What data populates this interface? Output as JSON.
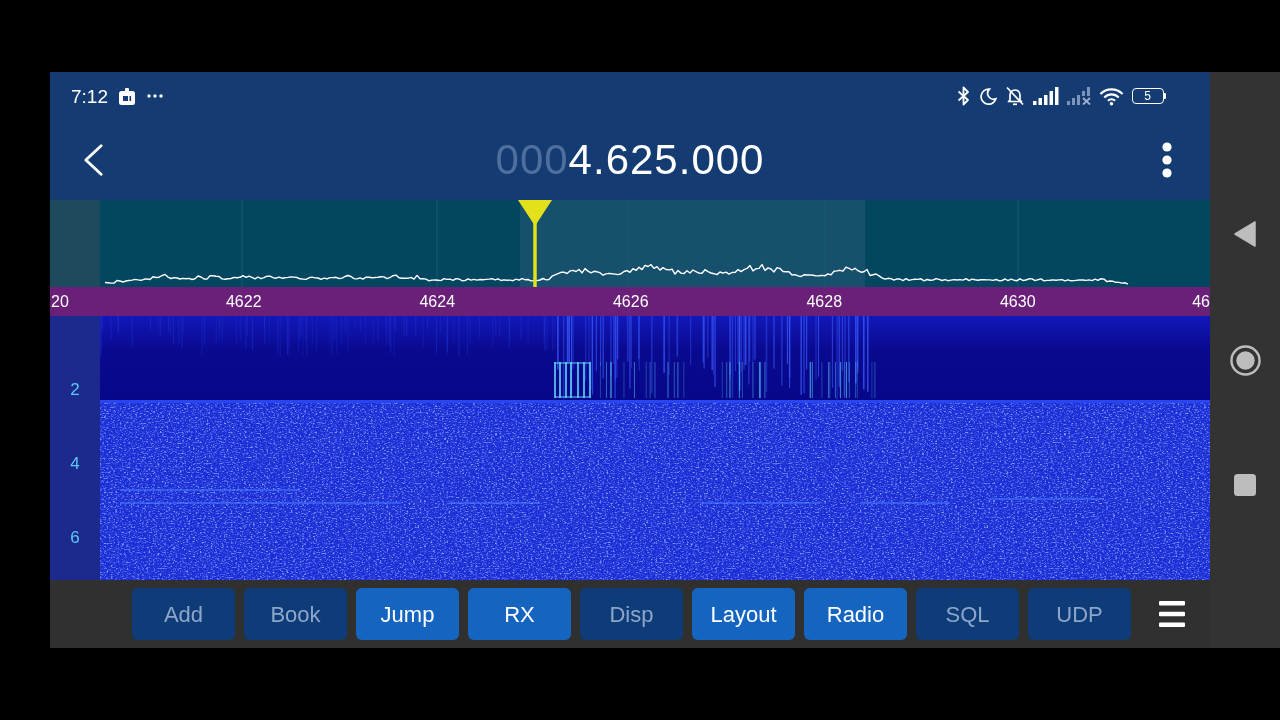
{
  "status_bar": {
    "time": "7:12",
    "battery": "5"
  },
  "header": {
    "frequency": {
      "leading_zeros": "000",
      "digits": "4.625.000"
    }
  },
  "spectrum": {
    "scale_labels": [
      "20",
      "4622",
      "4624",
      "4626",
      "4628",
      "4630",
      "46"
    ]
  },
  "waterfall": {
    "time_labels": [
      "2",
      "4",
      "6"
    ]
  },
  "toolbar": [
    {
      "label": "Add",
      "on": false
    },
    {
      "label": "Book",
      "on": false
    },
    {
      "label": "Jump",
      "on": true
    },
    {
      "label": "RX",
      "on": true
    },
    {
      "label": "Disp",
      "on": false
    },
    {
      "label": "Layout",
      "on": true
    },
    {
      "label": "Radio",
      "on": true
    },
    {
      "label": "SQL",
      "on": false
    },
    {
      "label": "UDP",
      "on": false
    }
  ]
}
